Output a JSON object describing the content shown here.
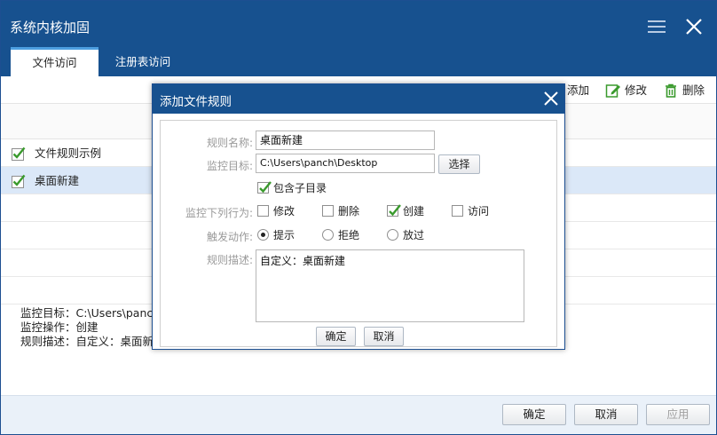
{
  "window": {
    "title": "系统内核加固",
    "tabs": [
      {
        "label": "文件访问",
        "active": true
      },
      {
        "label": "注册表访问",
        "active": false
      }
    ]
  },
  "toolbar": {
    "add_label": "添加",
    "edit_label": "修改",
    "delete_label": "删除"
  },
  "rules": [
    {
      "name": "文件规则示例",
      "checked": true,
      "selected": false
    },
    {
      "name": "桌面新建",
      "checked": true,
      "selected": true
    }
  ],
  "details": {
    "line1": "监控目标：C:\\Users\\panch",
    "line2": "监控操作：创建",
    "line3": "规则描述：自定义：桌面新建"
  },
  "footer": {
    "ok_label": "确定",
    "cancel_label": "取消",
    "apply_label": "应用"
  },
  "dialog": {
    "title": "添加文件规则",
    "name_label": "规则名称:",
    "name_value": "桌面新建",
    "target_label": "监控目标:",
    "target_value": "C:\\Users\\panch\\Desktop",
    "choose_label": "选择",
    "include_sub_label": "包含子目录",
    "include_sub_checked": true,
    "actions_label": "监控下列行为:",
    "actions": [
      {
        "label": "修改",
        "checked": false
      },
      {
        "label": "删除",
        "checked": false
      },
      {
        "label": "创建",
        "checked": true
      },
      {
        "label": "访问",
        "checked": false
      }
    ],
    "trigger_label": "触发动作:",
    "triggers": [
      {
        "label": "提示",
        "selected": true
      },
      {
        "label": "拒绝",
        "selected": false
      },
      {
        "label": "放过",
        "selected": false
      }
    ],
    "desc_label": "规则描述:",
    "desc_value": "自定义：桌面新建",
    "ok_label": "确定",
    "cancel_label": "取消"
  },
  "colors": {
    "titlebar": "#17518f",
    "accent_tab": "#4d9ee0",
    "check_green": "#3a9a2d",
    "selected_row": "#dbe8f8"
  }
}
